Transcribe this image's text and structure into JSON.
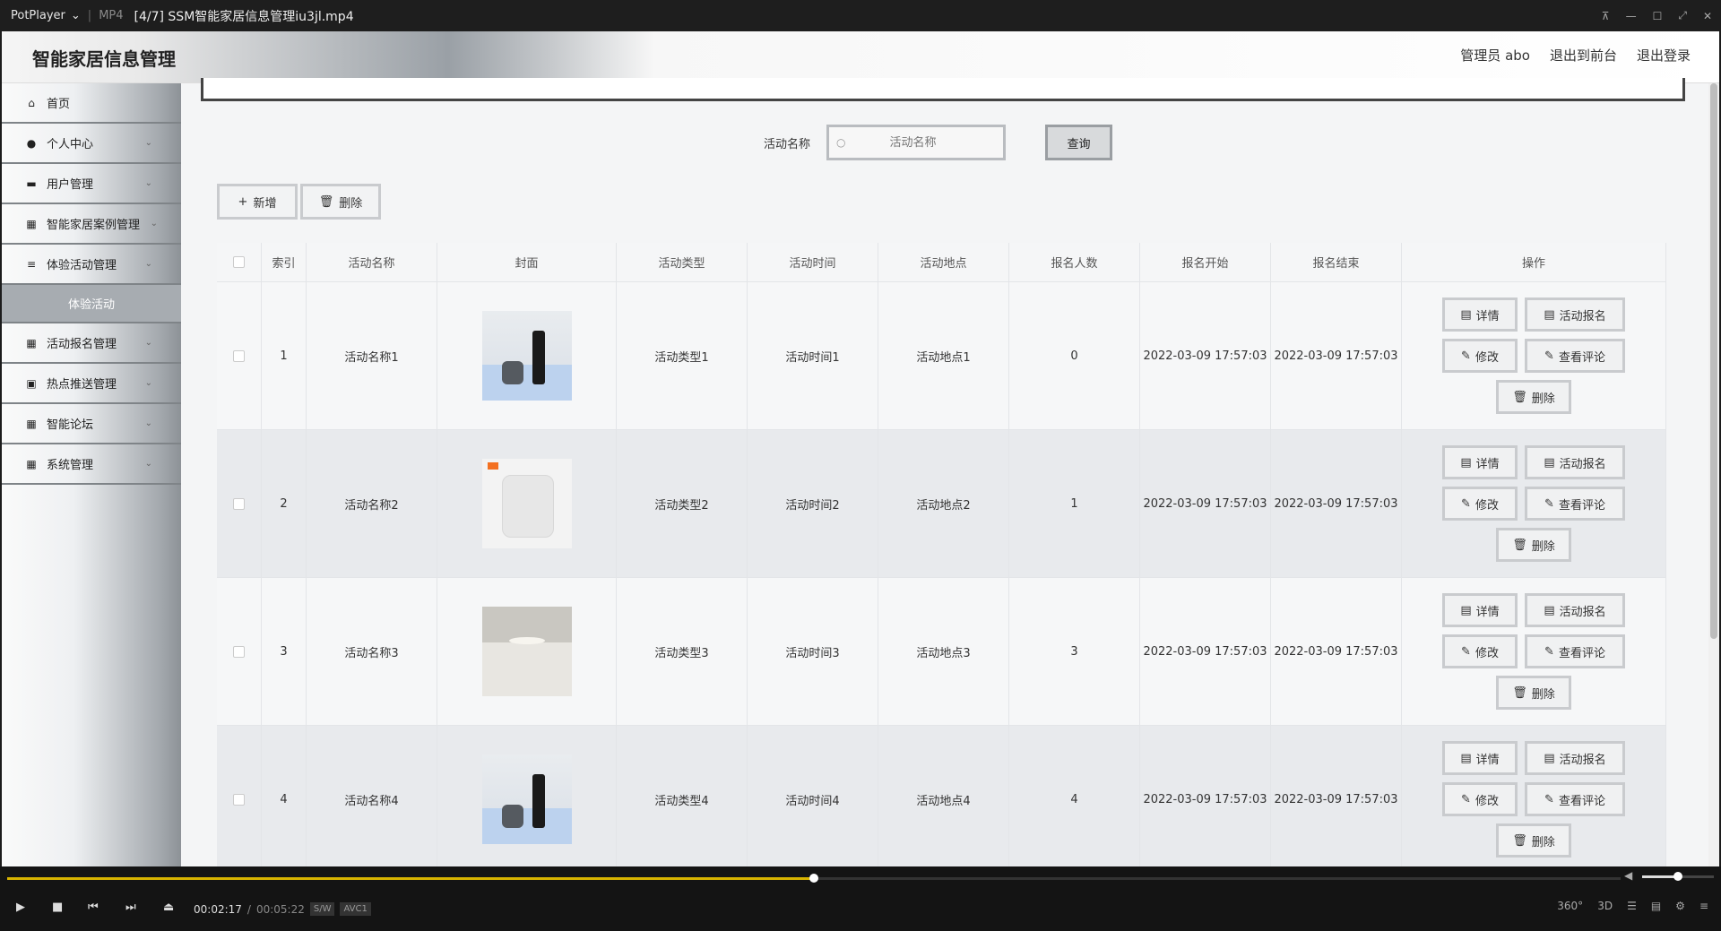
{
  "player": {
    "brand": "PotPlayer",
    "format": "MP4",
    "filename": "[4/7] SSM智能家居信息管理iu3jl.mp4",
    "time_current": "00:02:17",
    "time_separator": "/",
    "time_total": "00:05:22",
    "tag_sw": "S/W",
    "tag_codec": "AVC1",
    "progress_fraction": 0.5,
    "volume_fraction": 0.5,
    "right_controls": [
      "360°",
      "3D"
    ]
  },
  "header": {
    "site_title": "智能家居信息管理",
    "user": "管理员 abo",
    "to_front": "退出到前台",
    "logout": "退出登录"
  },
  "sidebar": {
    "items": [
      {
        "label": "首页",
        "icon": "home-icon"
      },
      {
        "label": "个人中心",
        "icon": "user-icon"
      },
      {
        "label": "用户管理",
        "icon": "monitor-icon"
      },
      {
        "label": "智能家居案例管理",
        "icon": "grid-icon"
      },
      {
        "label": "体验活动管理",
        "icon": "list-icon"
      },
      {
        "label": "活动报名管理",
        "icon": "grid-icon"
      },
      {
        "label": "热点推送管理",
        "icon": "clipboard-icon"
      },
      {
        "label": "智能论坛",
        "icon": "grid-icon"
      },
      {
        "label": "系统管理",
        "icon": "grid-icon"
      }
    ],
    "active_sub": "体验活动"
  },
  "search": {
    "label": "活动名称",
    "placeholder": "活动名称",
    "query_label": "查询"
  },
  "actions": {
    "add_label": "新增",
    "delete_label": "删除"
  },
  "table": {
    "headers": [
      "索引",
      "活动名称",
      "封面",
      "活动类型",
      "活动时间",
      "活动地点",
      "报名人数",
      "报名开始",
      "报名结束",
      "操作"
    ],
    "rows": [
      {
        "index": "1",
        "name": "活动名称1",
        "type": "活动类型1",
        "time": "活动时间1",
        "location": "活动地点1",
        "count": "0",
        "start": "2022-03-09 17:57:03",
        "end": "2022-03-09 17:57:03"
      },
      {
        "index": "2",
        "name": "活动名称2",
        "type": "活动类型2",
        "time": "活动时间2",
        "location": "活动地点2",
        "count": "1",
        "start": "2022-03-09 17:57:03",
        "end": "2022-03-09 17:57:03"
      },
      {
        "index": "3",
        "name": "活动名称3",
        "type": "活动类型3",
        "time": "活动时间3",
        "location": "活动地点3",
        "count": "3",
        "start": "2022-03-09 17:57:03",
        "end": "2022-03-09 17:57:03"
      },
      {
        "index": "4",
        "name": "活动名称4",
        "type": "活动类型4",
        "time": "活动时间4",
        "location": "活动地点4",
        "count": "4",
        "start": "2022-03-09 17:57:03",
        "end": "2022-03-09 17:57:03"
      }
    ],
    "ops": {
      "detail": "详情",
      "signup": "活动报名",
      "edit": "修改",
      "comments": "查看评论",
      "delete": "删除"
    }
  },
  "colors": {
    "accent_seek": "#d8b400",
    "sidebar_active": "#a7acb1"
  }
}
